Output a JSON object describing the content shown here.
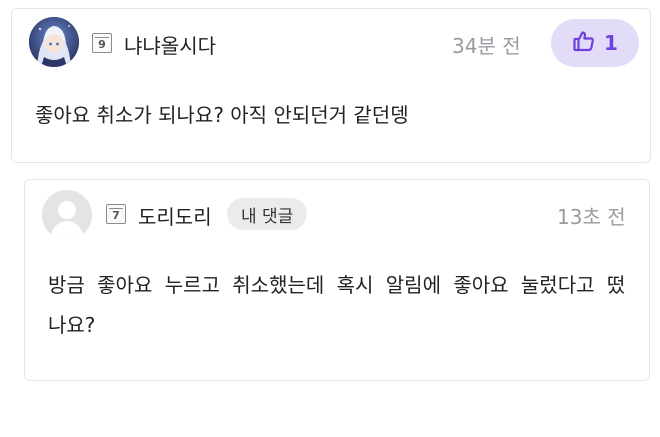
{
  "comments": [
    {
      "level": "9",
      "nickname": "냐냐올시다",
      "timestamp": "34분 전",
      "like_count": "1",
      "body": "좋아요 취소가 되나요? 아직 안되던거 같던뎅"
    },
    {
      "level": "7",
      "nickname": "도리도리",
      "tag": "내 댓글",
      "timestamp": "13초 전",
      "body": "방금 좋아요 누르고 취소했는데 혹시 알림에 좋아요 눌렀다고 떴나요?"
    }
  ],
  "icons": {
    "like": "thumbs-up-icon",
    "avatar_default": "person-silhouette-icon"
  },
  "colors": {
    "accent": "#6f3fe0",
    "like_bg": "#e3dcf9",
    "muted": "#9a9aa0",
    "tag_bg": "#ebebee"
  }
}
